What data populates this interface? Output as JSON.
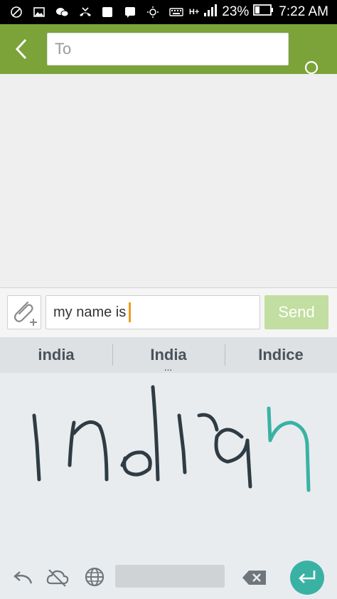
{
  "status_bar": {
    "signal": "H+",
    "battery_percent": "23%",
    "time": "7:22 AM"
  },
  "header": {
    "to_placeholder": "To"
  },
  "compose": {
    "message_text": "my name is",
    "send_label": "Send"
  },
  "keyboard": {
    "suggestions": [
      "india",
      "India",
      "Indice"
    ],
    "more_indicator": "...",
    "ink_accent_color": "#39b2a4",
    "ink_color": "#2f3c44"
  },
  "colors": {
    "app_bar": "#7ba33a",
    "send_disabled": "#c2dea0",
    "caret": "#f29a1d"
  }
}
